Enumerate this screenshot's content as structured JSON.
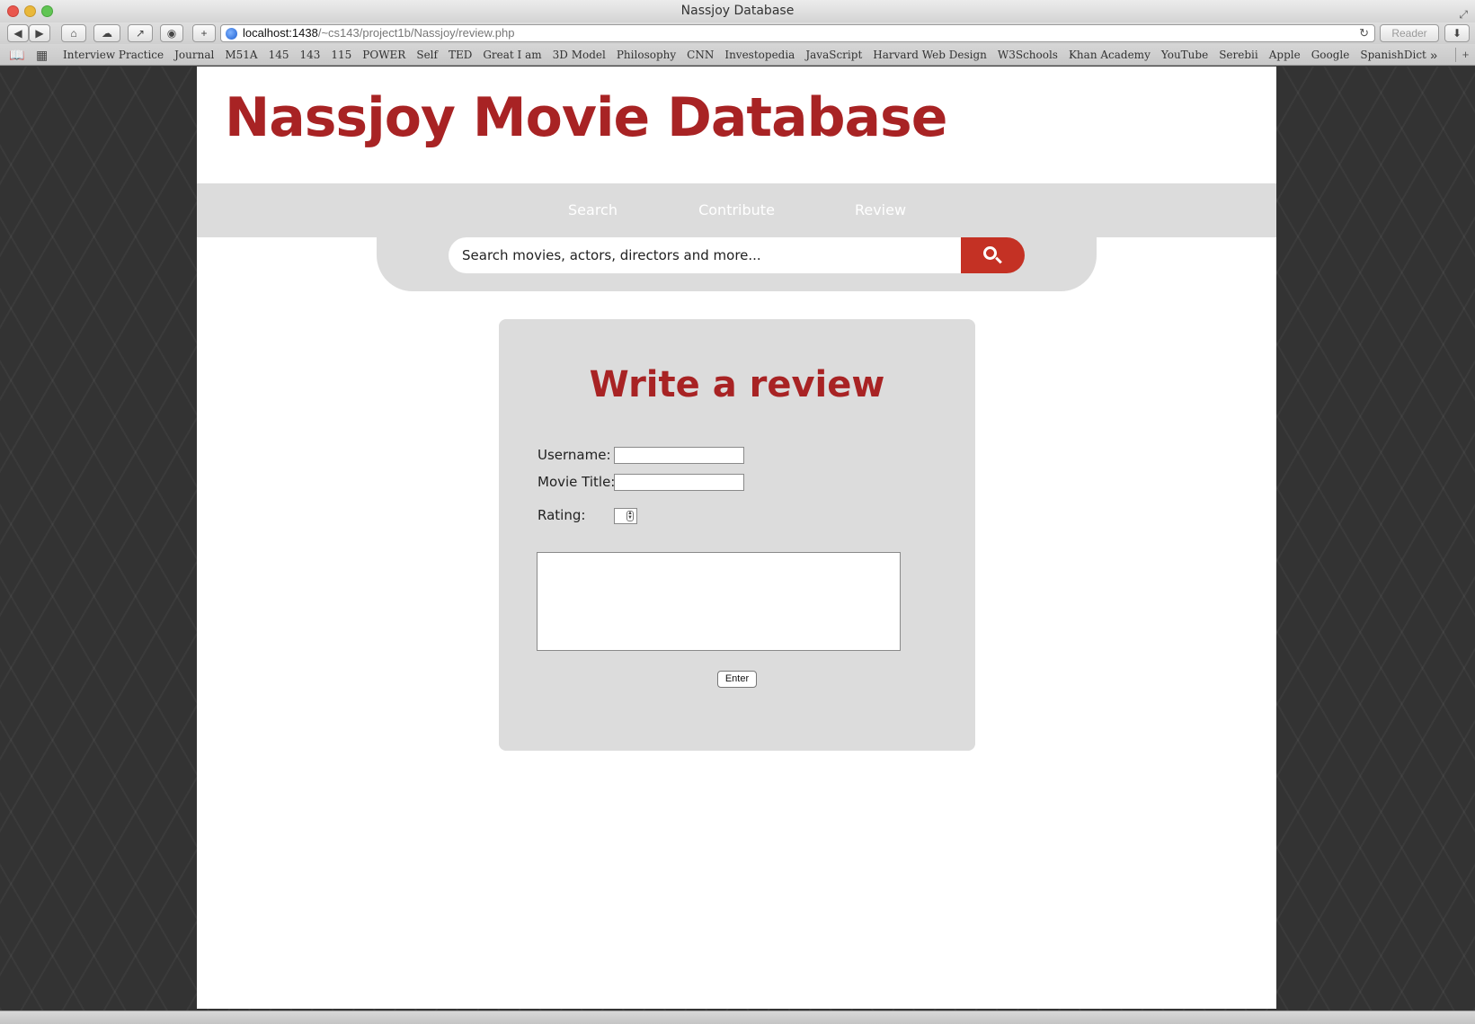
{
  "window": {
    "title": "Nassjoy Database"
  },
  "toolbar": {
    "back_icon": "back-arrow-icon",
    "forward_icon": "forward-arrow-icon",
    "home_icon": "home-icon",
    "icloud_icon": "cloud-icon",
    "share_icon": "share-icon",
    "new_tab_icon": "plus-icon",
    "url_host": "localhost:1438",
    "url_path": "/~cs143/project1b/Nassjoy/review.php",
    "reader_label": "Reader"
  },
  "bookmarks": {
    "items": [
      "Interview Practice",
      "Journal",
      "M51A",
      "145",
      "143",
      "115",
      "POWER",
      "Self",
      "TED",
      "Great I am",
      "3D Model",
      "Philosophy",
      "CNN",
      "Investopedia",
      "JavaScript",
      "Harvard Web Design",
      "W3Schools",
      "Khan Academy",
      "YouTube",
      "Serebii",
      "Apple",
      "Google",
      "SpanishDict"
    ]
  },
  "site": {
    "title": "Nassjoy Movie Database",
    "brand_color": "#a82324"
  },
  "nav": {
    "links": [
      "Search",
      "Contribute",
      "Review"
    ]
  },
  "search": {
    "placeholder": "Search movies, actors, directors and more...",
    "button_color": "#c43124"
  },
  "review_form": {
    "heading": "Write a review",
    "username_label": "Username:",
    "username_value": "",
    "movie_title_label": "Movie Title:",
    "movie_title_value": "",
    "rating_label": "Rating:",
    "rating_value": "",
    "review_text": "",
    "submit_label": "Enter"
  }
}
